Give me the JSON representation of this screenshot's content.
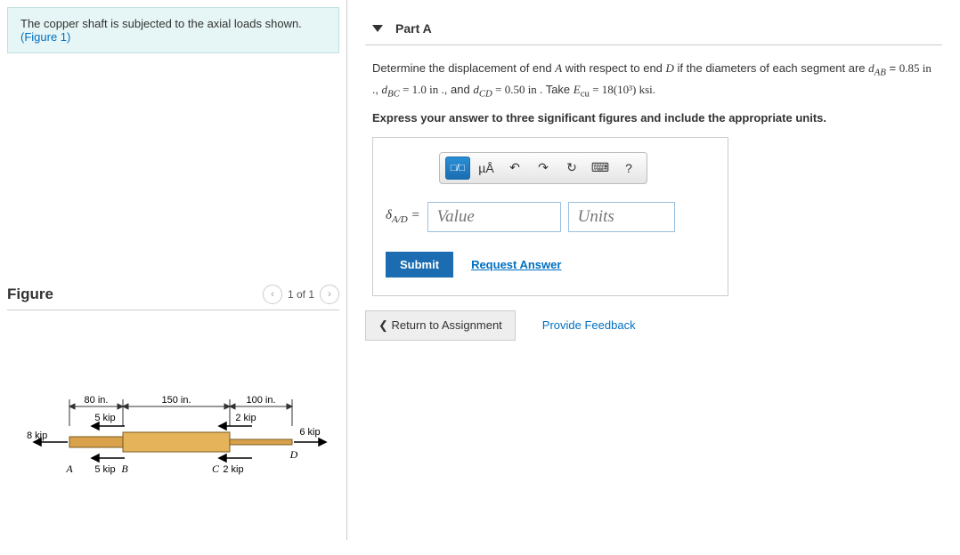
{
  "problem": {
    "text": "The copper shaft is subjected to the axial loads shown.",
    "figure_link": "(Figure 1)"
  },
  "figure_section": {
    "title": "Figure",
    "pager": "1 of 1"
  },
  "figure_labels": {
    "len_ab": "80 in.",
    "len_bc": "150 in.",
    "len_cd": "100 in.",
    "load_a": "8 kip",
    "load_b_top": "5 kip",
    "load_b_bot": "5 kip",
    "load_c_top": "2 kip",
    "load_c_bot": "2 kip",
    "load_d": "6 kip",
    "A": "A",
    "B": "B",
    "C": "C",
    "D": "D"
  },
  "part": {
    "label": "Part A",
    "question_prefix": "Determine the displacement of end ",
    "q_A": "A",
    "q_mid1": " with respect to end ",
    "q_D": "D",
    "q_mid2": " if the diameters of each segment are ",
    "d_ab_sym": "d",
    "d_ab_sub": "AB",
    "eq": " = ",
    "d_ab_val": "0.85  in .",
    "comma1": ", ",
    "d_bc_sym": "d",
    "d_bc_sub": "BC",
    "d_bc_val": " = 1.0  in .",
    "comma2": ", and ",
    "d_cd_sym": "d",
    "d_cd_sub": "CD",
    "d_cd_val": " = 0.50  in .",
    "take": " Take ",
    "E_sym": "E",
    "E_sub": "cu",
    "E_val": " = 18(10³) ksi.",
    "instruction": "Express your answer to three significant figures and include the appropriate units."
  },
  "toolbar": {
    "tpl_label": "□/□",
    "units_btn": "µÅ",
    "undo": "↶",
    "redo": "↷",
    "reset": "↻",
    "keyboard": "⌨",
    "help": "?"
  },
  "answer": {
    "lhs_delta": "δ",
    "lhs_sub": "A/D",
    "lhs_eq": " = ",
    "value_ph": "Value",
    "units_ph": "Units"
  },
  "actions": {
    "submit": "Submit",
    "request": "Request Answer",
    "return": "❮ Return to Assignment",
    "feedback": "Provide Feedback"
  }
}
